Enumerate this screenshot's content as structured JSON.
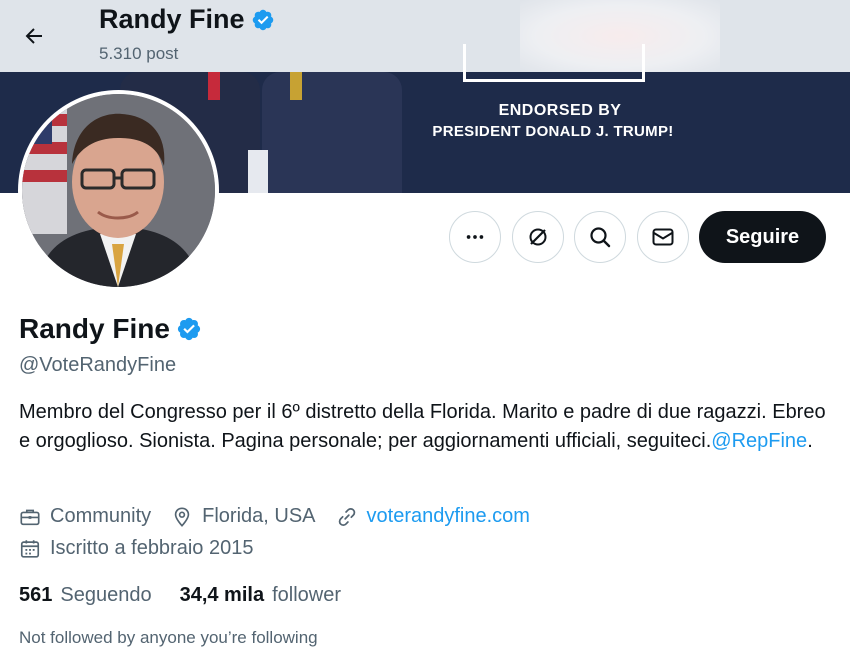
{
  "header": {
    "name": "Randy Fine",
    "post_count": "5.310 post"
  },
  "banner": {
    "line1": "ENDORSED BY",
    "line2": "PRESIDENT DONALD J. TRUMP!"
  },
  "actions": {
    "follow_label": "Seguire"
  },
  "profile": {
    "display_name": "Randy Fine",
    "handle": "@VoteRandyFine",
    "bio_text": "Membro del Congresso per il 6º distretto della Florida. Marito e padre di due ragazzi. Ebreo e orgoglioso. Sionista. Pagina personale; per aggiornamenti ufficiali, seguiteci.",
    "bio_mention": "@RepFine",
    "bio_end": ".",
    "category": "Community",
    "location": "Florida, USA",
    "website": "voterandyfine.com",
    "joined": "Iscritto a febbraio 2015",
    "following_count": "561",
    "following_label": "Seguendo",
    "followers_count": "34,4 mila",
    "followers_label": "follower",
    "not_followed": "Not followed by anyone you’re following"
  },
  "colors": {
    "accent": "#1d9bf0",
    "text": "#0f1419",
    "secondary": "#536471",
    "banner": "#1e2b4a"
  }
}
